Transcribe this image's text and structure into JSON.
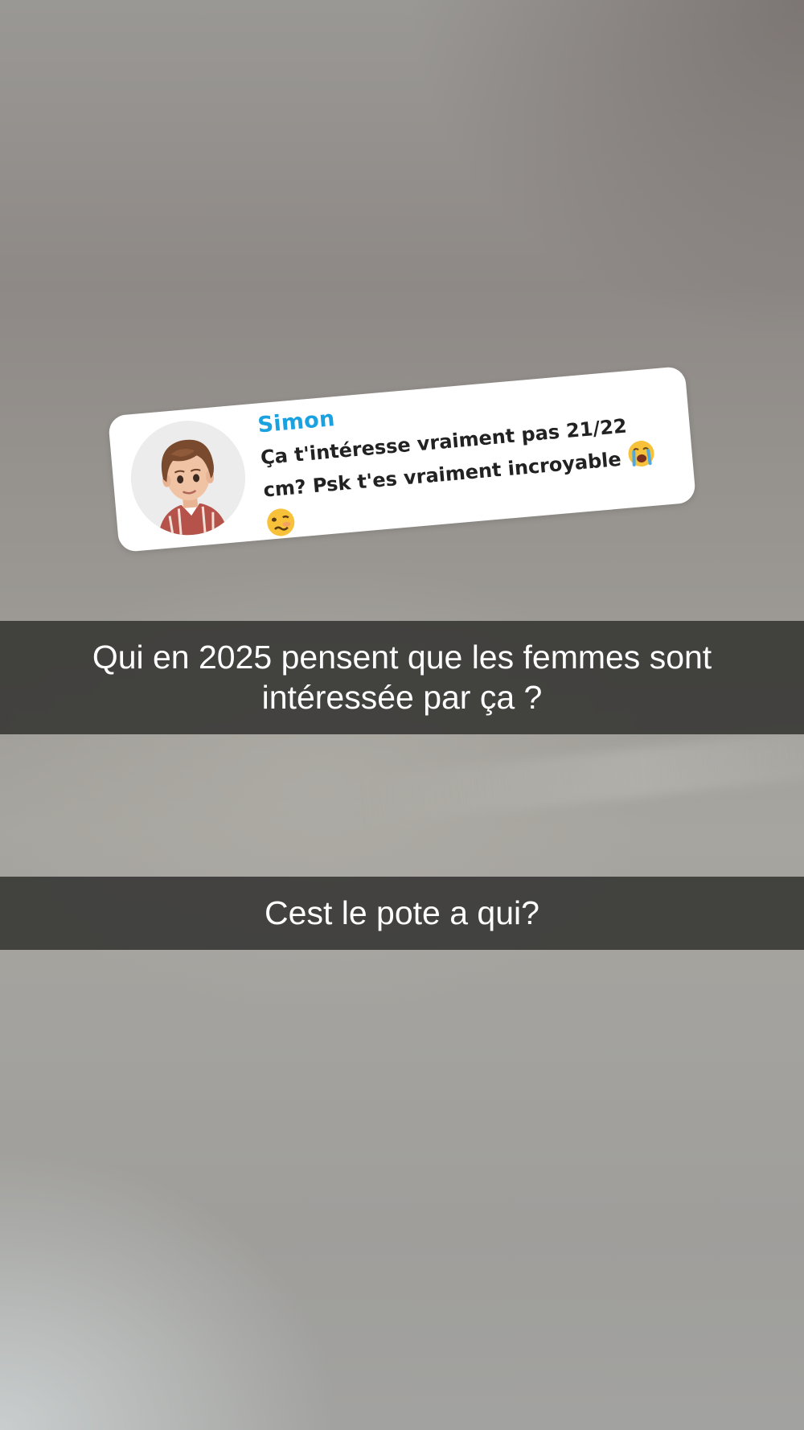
{
  "reply": {
    "name": "Simon",
    "message_line1": "Ça t'intéresse vraiment pas 21/22",
    "message_line2": "cm? Psk t'es vraiment incroyable",
    "emoji_1": "loudly-crying-face-icon",
    "emoji_2": "woozy-face-icon"
  },
  "captions": [
    {
      "line1": "Qui en 2025 pensent que les femmes sont",
      "line2": "intéressée par ça ?"
    },
    {
      "text": "Cest le pote a qui?"
    }
  ],
  "colors": {
    "name_accent": "#1aa1e0",
    "caption_bg": "#343432",
    "caption_text": "#ffffff"
  }
}
